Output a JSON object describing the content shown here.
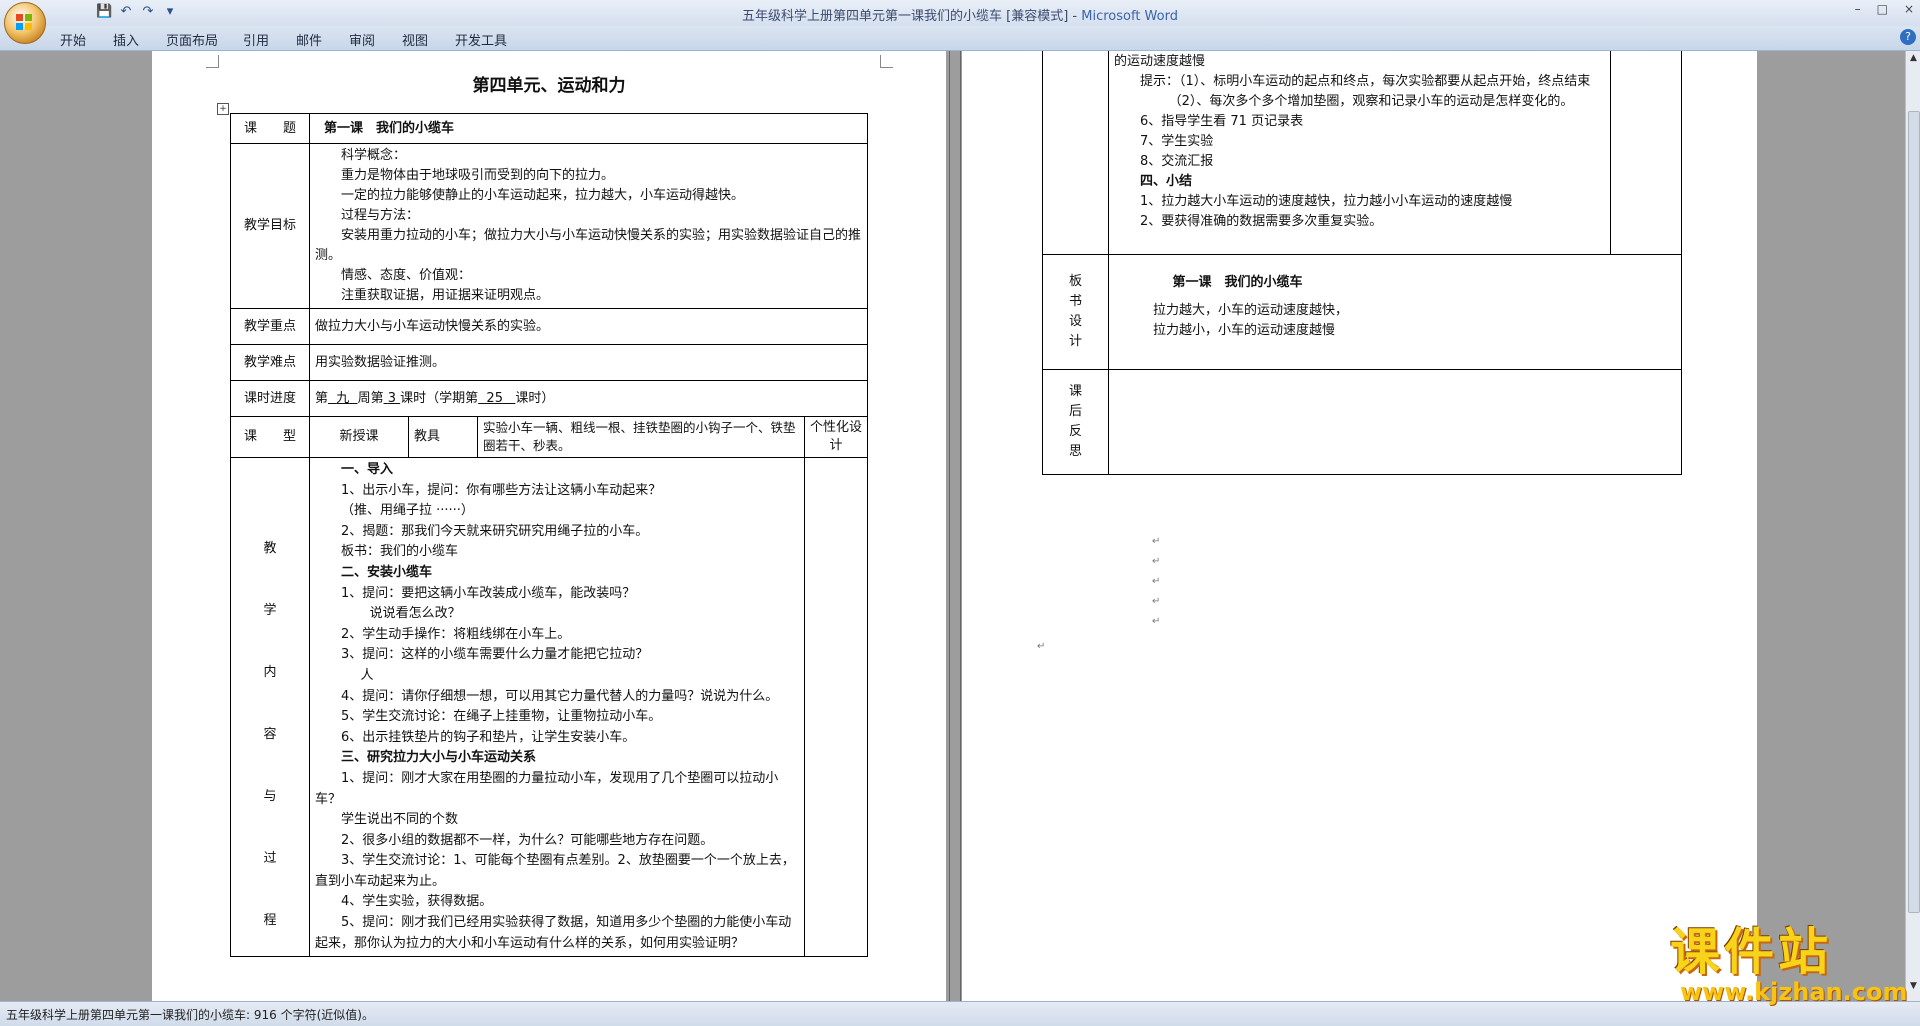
{
  "window": {
    "title": "五年级科学上册第四单元第一课我们的小缆车 [兼容模式]",
    "app": "Microsoft Word",
    "controls": [
      "–",
      "□",
      "×"
    ]
  },
  "ribbon": {
    "tabs": [
      "开始",
      "插入",
      "页面布局",
      "引用",
      "邮件",
      "审阅",
      "视图",
      "开发工具"
    ]
  },
  "status": {
    "text": "五年级科学上册第四单元第一课我们的小缆车: 916 个字符(近似值)。"
  },
  "page1": {
    "heading": "第四单元、运动和力",
    "topic_label": "课　　题",
    "topic": "第一课　我们的小缆车",
    "goals_label": "教学目标",
    "goals": [
      "科学概念：",
      "重力是物体由于地球吸引而受到的向下的拉力。",
      "一定的拉力能够使静止的小车运动起来，拉力越大，小车运动得越快。",
      "过程与方法：",
      "安装用重力拉动的小车；做拉力大小与小车运动快慢关系的实验；用实验数据验证自己的推测。",
      "情感、态度、价值观：",
      "注重获取证据，用证据来证明观点。"
    ],
    "focus_label": "教学重点",
    "focus": "做拉力大小与小车运动快慢关系的实验。",
    "difficulty_label": "教学难点",
    "difficulty": "用实验数据验证推测。",
    "progress_label": "课时进度",
    "progress": {
      "pre": "第",
      "week": "九",
      "mid1": "周第",
      "hour": "3",
      "mid2": "课时（学期第",
      "term": "25",
      "post": "课时）"
    },
    "type_label": "课　　型",
    "type": "新授课",
    "tools_label": "教具",
    "tools": "实验小车一辆、粗线一根、挂铁垫圈的小钩子一个、铁垫圈若干、秒表。",
    "personal_label": "个性化设计",
    "content_label": [
      "教",
      "学",
      "内",
      "容",
      "与",
      "过",
      "程"
    ],
    "content": [
      {
        "t": "一、导入",
        "b": true
      },
      {
        "t": "1、出示小车，提问：你有哪些方法让这辆小车动起来？"
      },
      {
        "t": "（推、用绳子拉 ······）"
      },
      {
        "t": "2、揭题：那我们今天就来研究研究用绳子拉的小车。"
      },
      {
        "t": "板书：我们的小缆车"
      },
      {
        "t": "二、安装小缆车",
        "b": true
      },
      {
        "t": "1、提问：要把这辆小车改装成小缆车，能改装吗？"
      },
      {
        "t": "说说看怎么改？"
      },
      {
        "t": "2、学生动手操作：将粗线绑在小车上。"
      },
      {
        "t": "3、提问：这样的小缆车需要什么力量才能把它拉动？"
      },
      {
        "t": "人"
      },
      {
        "t": "4、提问：请你仔细想一想，可以用其它力量代替人的力量吗？说说为什么。"
      },
      {
        "t": "5、学生交流讨论：在绳子上挂重物，让重物拉动小车。"
      },
      {
        "t": "6、出示挂铁垫片的钩子和垫片，让学生安装小车。"
      },
      {
        "t": "三、研究拉力大小与小车运动关系",
        "b": true
      },
      {
        "t": "1、提问：刚才大家在用垫圈的力量拉动小车，发现用了几个垫圈可以拉动小车？"
      },
      {
        "t": "学生说出不同的个数"
      },
      {
        "t": "2、很多小组的数据都不一样，为什么？可能哪些地方存在问题。"
      },
      {
        "t": "3、学生交流讨论：1、可能每个垫圈有点差别。2、放垫圈要一个一个放上去，直到小车动起来为止。"
      },
      {
        "t": "4、学生实验，获得数据。"
      },
      {
        "t": "5、提问：刚才我们已经用实验获得了数据，知道用多少个垫圈的力能使小车动起来，那你认为拉力的大小和小车运动有什么样的关系，如何用实验证明？"
      }
    ]
  },
  "page2": {
    "cont": [
      {
        "t": "的运动速度越慢"
      },
      {
        "t": "提示：（1）、标明小车运动的起点和终点，每次实验都要从起点开始，终点结束"
      },
      {
        "t": "（2）、每次多个多个增加垫圈，观察和记录小车的运动是怎样变化的。"
      },
      {
        "t": "6、指导学生看 71 页记录表"
      },
      {
        "t": "7、学生实验"
      },
      {
        "t": "8、交流汇报"
      },
      {
        "t": "四、小结",
        "b": true
      },
      {
        "t": "1、拉力越大小车运动的速度越快，拉力越小小车运动的速度越慢"
      },
      {
        "t": "2、要获得准确的数据需要多次重复实验。"
      }
    ],
    "board_label": [
      "板",
      "书",
      "设",
      "计"
    ],
    "board_title": "第一课　我们的小缆车",
    "board_lines": [
      "拉力越大，小车的运动速度越快，",
      "拉力越小，小车的运动速度越慢"
    ],
    "reflect_label": [
      "课",
      "后",
      "反",
      "思"
    ]
  },
  "watermark": {
    "big": "课件站",
    "url": "www.kjzhan.com"
  }
}
